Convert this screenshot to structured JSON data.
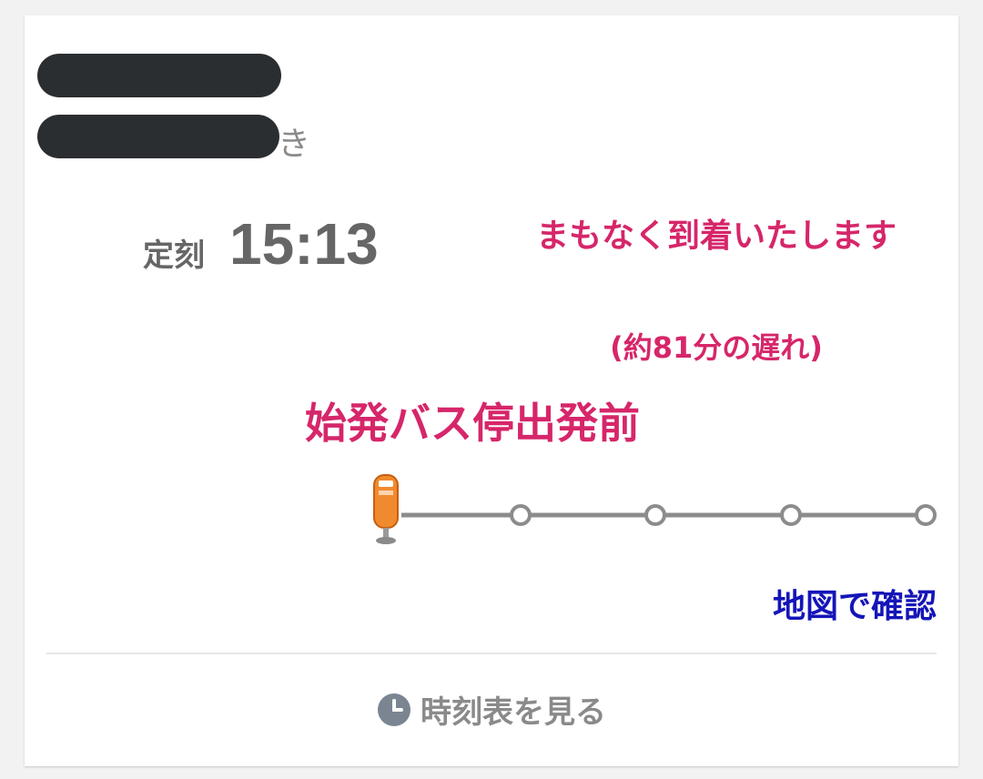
{
  "route": {
    "destination_suffix": "き"
  },
  "schedule": {
    "label": "定刻",
    "time": "15:13"
  },
  "arrival": {
    "message": "まもなく到着いたします",
    "delay": "(約81分の遅れ)"
  },
  "status": {
    "text": "始発バス停出発前"
  },
  "progress": {
    "current_stop_index": 0,
    "stop_count": 5
  },
  "links": {
    "map": "地図で確認",
    "timetable": "時刻表を見る"
  },
  "colors": {
    "alert": "#d6266a",
    "link": "#1515b8",
    "muted": "#666666",
    "track": "#8c8c8c",
    "bus": "#f08a2e"
  },
  "icons": {
    "bus": "bus-stop-marker-icon",
    "clock": "clock-icon"
  }
}
